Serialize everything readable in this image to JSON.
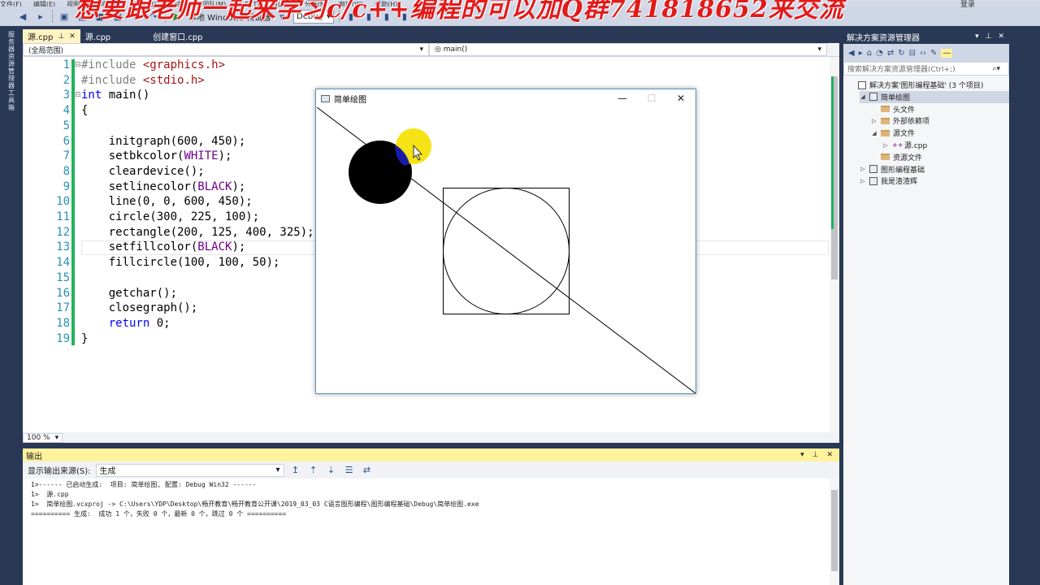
{
  "watermark": "想要跟老师一起来学习c/c++编程的可以加Q群741818652来交流",
  "menubar": [
    "文件(F)",
    "编辑(E)",
    "视图(V)",
    "项目(P)",
    "生成(B)",
    "调试(D)",
    "团队(M)",
    "工具(T)",
    "测试(S)",
    "分析(N)",
    "窗口(W)",
    "帮助(H)"
  ],
  "login": "登录",
  "toolbar": {
    "debugger_label": "本地 Windows 调试器",
    "config": "Debug"
  },
  "left_strip_label": "服务器资源管理器 工具箱",
  "editor": {
    "tabs": [
      {
        "label": "源.cpp",
        "active": true
      },
      {
        "label": "源.cpp",
        "active": false
      },
      {
        "label": "创建窗口.cpp",
        "active": false
      }
    ],
    "scope": "(全局范围)",
    "member": "main()",
    "zoom": "100 %",
    "lines": [
      {
        "n": "1",
        "html": "<span class=\"pp\">#include</span> <span class=\"str\">&lt;graphics.h&gt;</span>"
      },
      {
        "n": "2",
        "html": "<span class=\"pp\">#include</span> <span class=\"str\">&lt;stdio.h&gt;</span>"
      },
      {
        "n": "3",
        "html": "<span class=\"kw\">int</span> main()"
      },
      {
        "n": "4",
        "html": "{"
      },
      {
        "n": "5",
        "html": ""
      },
      {
        "n": "6",
        "html": "    initgraph(600, 450);"
      },
      {
        "n": "7",
        "html": "    setbkcolor(<span class=\"mac\">WHITE</span>);"
      },
      {
        "n": "8",
        "html": "    cleardevice();"
      },
      {
        "n": "9",
        "html": "    setlinecolor(<span class=\"mac\">BLACK</span>);"
      },
      {
        "n": "10",
        "html": "    line(0, 0, 600, 450);"
      },
      {
        "n": "11",
        "html": "    circle(300, 225, 100);"
      },
      {
        "n": "12",
        "html": "    rectangle(200, 125, 400, 325);"
      },
      {
        "n": "13",
        "html": "    setfillcolor(<span class=\"mac\">BLACK</span>);"
      },
      {
        "n": "14",
        "html": "    fillcircle(100, 100, 50);"
      },
      {
        "n": "15",
        "html": ""
      },
      {
        "n": "16",
        "html": "    getchar();"
      },
      {
        "n": "17",
        "html": "    closegraph();"
      },
      {
        "n": "18",
        "html": "    <span class=\"kw\">return</span> 0;"
      },
      {
        "n": "19",
        "html": "}"
      }
    ]
  },
  "graphics_window": {
    "title": "简单绘图",
    "minimize": "—",
    "maximize": "☐",
    "close": "✕"
  },
  "output": {
    "title": "输出",
    "source_label": "显示输出来源(S):",
    "source_value": "生成",
    "lines": [
      "1>------ 已启动生成:  项目: 简单绘图, 配置: Debug Win32 ------",
      "1>  源.cpp",
      "1>  简单绘图.vcxproj -> C:\\Users\\YDP\\Desktop\\畅开教育\\畅开教育公开课\\2019_03_03 C语言图形编程\\图形编程基础\\Debug\\简单绘图.exe",
      "========== 生成:  成功 1 个，失败 0 个，最新 0 个，跳过 0 个 =========="
    ]
  },
  "solution_explorer": {
    "title": "解决方案资源管理器",
    "search_placeholder": "搜索解决方案资源管理器(Ctrl+;)",
    "items": [
      {
        "label": "解决方案'图形编程基础' (3 个项目)",
        "indent": 0,
        "arrow": "",
        "icon": "sol",
        "selected": false
      },
      {
        "label": "简单绘图",
        "indent": 1,
        "arrow": "◢",
        "icon": "proj",
        "selected": true
      },
      {
        "label": "头文件",
        "indent": 2,
        "arrow": "",
        "icon": "folder",
        "selected": false
      },
      {
        "label": "外部依赖项",
        "indent": 2,
        "arrow": "▷",
        "icon": "folder",
        "selected": false
      },
      {
        "label": "源文件",
        "indent": 2,
        "arrow": "◢",
        "icon": "folder",
        "selected": false
      },
      {
        "label": "源.cpp",
        "indent": 3,
        "arrow": "▷",
        "icon": "cpp",
        "selected": false
      },
      {
        "label": "资源文件",
        "indent": 2,
        "arrow": "",
        "icon": "folder",
        "selected": false
      },
      {
        "label": "图形编程基础",
        "indent": 1,
        "arrow": "▷",
        "icon": "proj",
        "selected": false
      },
      {
        "label": "我是渣渣辉",
        "indent": 1,
        "arrow": "▷",
        "icon": "proj",
        "selected": false
      }
    ]
  },
  "colors": {
    "accent": "#293955",
    "tab_active": "#fff3c2",
    "output_title": "#fff29d",
    "change_bar": "#1fb25a"
  }
}
